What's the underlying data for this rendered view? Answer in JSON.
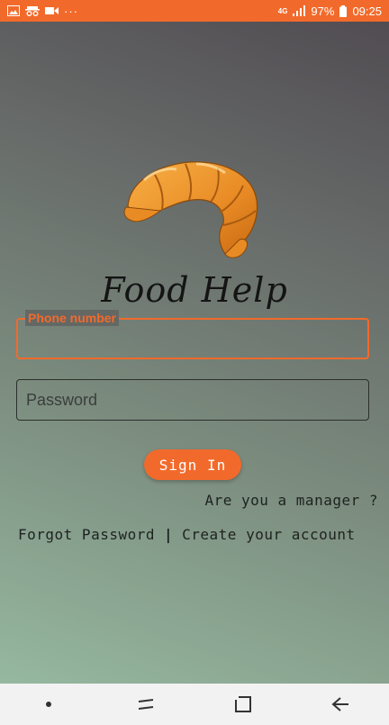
{
  "status_bar": {
    "notification_icons": [
      "image-icon",
      "incognito-icon",
      "video-icon"
    ],
    "more_dots": "···",
    "network": "4G",
    "battery": "97%",
    "time": "09:25"
  },
  "app": {
    "brand": "Food Help",
    "logo_icon": "croissant-icon",
    "phone_label": "Phone number",
    "phone_value": "",
    "password_placeholder": "Password",
    "password_value": "",
    "signin_label": "Sign In",
    "manager_link": "Are you a manager ?",
    "forgot_password": "Forgot Password",
    "separator": "|",
    "create_account": "Create your account"
  },
  "nav_bar": {
    "items": [
      "dot-icon",
      "recents-icon",
      "home-icon",
      "back-icon"
    ]
  },
  "colors": {
    "accent": "#f26a2b",
    "text_dark": "#1e221f"
  }
}
